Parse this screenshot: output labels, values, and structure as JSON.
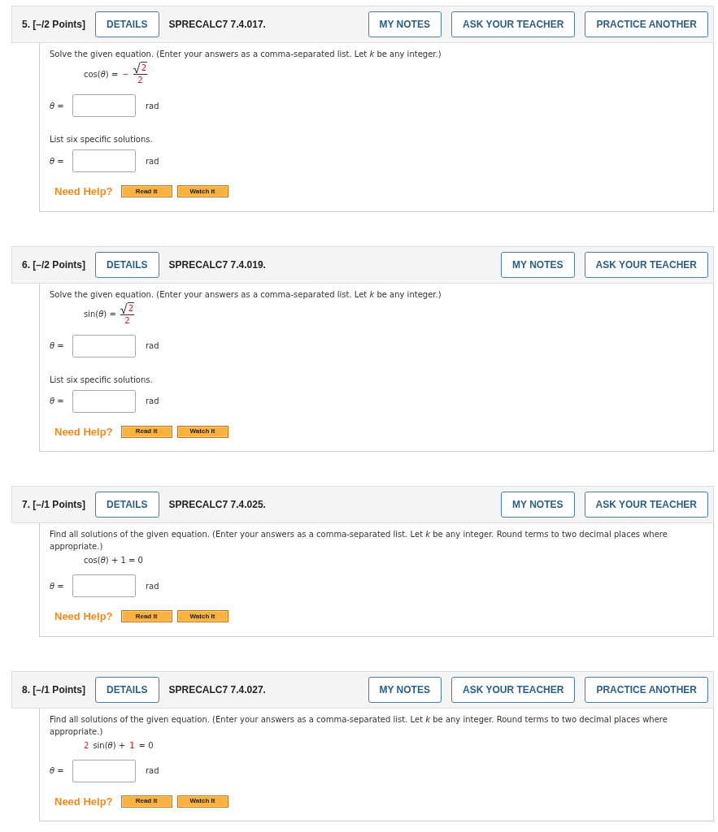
{
  "questions": [
    {
      "number": "5.",
      "points": "[–/2 Points]",
      "details": "DETAILS",
      "code": "SPRECALC7 7.4.017.",
      "actions": [
        "MY NOTES",
        "ASK YOUR TEACHER",
        "PRACTICE ANOTHER"
      ],
      "prompt": "Solve the given equation. (Enter your answers as a comma-separated list. Let *k* be any integer.)",
      "equation": [
        {
          "kind": "text",
          "text": "cos(*θ*) ="
        },
        {
          "kind": "given",
          "text": "−"
        },
        {
          "kind": "root_fraction",
          "numerator": "2",
          "denominator": "2"
        }
      ],
      "blocks": [
        {
          "kind": "answer",
          "label": "*θ* =",
          "unit": "rad"
        },
        {
          "kind": "note",
          "text": "List six specific solutions."
        },
        {
          "kind": "answer",
          "label": "*θ* =",
          "unit": "rad"
        }
      ],
      "help": {
        "label": "Need Help?",
        "buttons": [
          "Read It",
          "Watch It"
        ]
      }
    },
    {
      "number": "6.",
      "points": "[–/2 Points]",
      "details": "DETAILS",
      "code": "SPRECALC7 7.4.019.",
      "actions": [
        "MY NOTES",
        "ASK YOUR TEACHER"
      ],
      "prompt": "Solve the given equation. (Enter your answers as a comma-separated list. Let *k* be any integer.)",
      "equation": [
        {
          "kind": "text",
          "text": "sin(*θ*) ="
        },
        {
          "kind": "root_fraction",
          "numerator": "2",
          "denominator": "2"
        }
      ],
      "blocks": [
        {
          "kind": "answer",
          "label": "*θ* =",
          "unit": "rad"
        },
        {
          "kind": "note",
          "text": "List six specific solutions."
        },
        {
          "kind": "answer",
          "label": "*θ* =",
          "unit": "rad"
        }
      ],
      "help": {
        "label": "Need Help?",
        "buttons": [
          "Read It",
          "Watch It"
        ]
      }
    },
    {
      "number": "7.",
      "points": "[–/1 Points]",
      "details": "DETAILS",
      "code": "SPRECALC7 7.4.025.",
      "actions": [
        "MY NOTES",
        "ASK YOUR TEACHER"
      ],
      "prompt": "Find all solutions of the given equation. (Enter your answers as a comma-separated list. Let *k* be any integer. Round terms to two decimal places where appropriate.)",
      "equation": [
        {
          "kind": "text",
          "text": "cos(*θ*) + 1 = 0"
        }
      ],
      "blocks": [
        {
          "kind": "answer",
          "label": "*θ* =",
          "unit": "rad"
        }
      ],
      "help": {
        "label": "Need Help?",
        "buttons": [
          "Read It",
          "Watch It"
        ]
      }
    },
    {
      "number": "8.",
      "points": "[–/1 Points]",
      "details": "DETAILS",
      "code": "SPRECALC7 7.4.027.",
      "actions": [
        "MY NOTES",
        "ASK YOUR TEACHER",
        "PRACTICE ANOTHER"
      ],
      "prompt": "Find all solutions of the given equation. (Enter your answers as a comma-separated list. Let *k* be any integer. Round terms to two decimal places where appropriate.)",
      "equation": [
        {
          "kind": "given",
          "text": "2"
        },
        {
          "kind": "text",
          "text": "sin(*θ*) +"
        },
        {
          "kind": "given",
          "text": "1"
        },
        {
          "kind": "text",
          "text": "= 0"
        }
      ],
      "blocks": [
        {
          "kind": "answer",
          "label": "*θ* =",
          "unit": "rad"
        }
      ],
      "help": {
        "label": "Need Help?",
        "buttons": [
          "Read It",
          "Watch It"
        ]
      }
    }
  ]
}
